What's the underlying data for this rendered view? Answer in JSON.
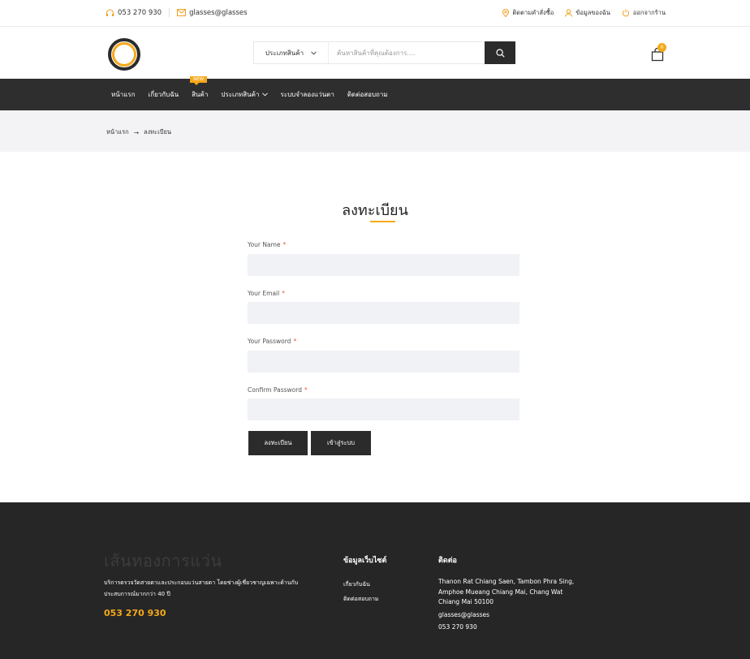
{
  "topbar": {
    "phone": "053 270 930",
    "email": "glasses@glasses",
    "track_order": "ติดตามคำสั่งซื้อ",
    "my_account": "ข้อมูลของฉัน",
    "logout": "ออกจากร้าน"
  },
  "header": {
    "search_category": "ประเภทสินค้า",
    "search_placeholder": "ค้นหาสินค้าที่คุณต้องการ....",
    "cart_count": "0"
  },
  "nav": {
    "items": [
      {
        "label": "หน้าแรก"
      },
      {
        "label": "เกี่ยวกับฉัน"
      },
      {
        "label": "สินค้า",
        "badge": "NEW"
      },
      {
        "label": "ประเภทสินค้า"
      },
      {
        "label": "ระบบจำลองแว่นตา"
      },
      {
        "label": "ติดต่อสอบถาม"
      }
    ]
  },
  "breadcrumb": {
    "home": "หน้าแรก",
    "arrow": "→",
    "current": "ลงทะเบียน"
  },
  "form": {
    "title": "ลงทะเบียน",
    "name_label": "Your Name",
    "email_label": "Your Email",
    "password_label": "Your Password",
    "confirm_label": "Confirm Password",
    "required_mark": "*",
    "register_button": "ลงทะเบียน",
    "login_button": "เข้าสู่ระบบ"
  },
  "footer": {
    "brand": "เส้นทองการแว่น",
    "description": "บริการตรวจวัดสายตาและประกอบแว่นสายตา โดยช่างผู้เชี่ยวชาญเฉพาะด้านกับประสบการณ์มากกว่า 40 ปี",
    "phone": "053 270 930",
    "info_heading": "ข้อมูลเว็บไซต์",
    "info_links": [
      "เกี่ยวกับฉัน",
      "ติดต่อสอบถาม"
    ],
    "contact_heading": "ติดต่อ",
    "address": "Thanon Rat Chiang Saen, Tambon Phra Sing, Amphoe Mueang Chiang Mai, Chang Wat Chiang Mai 50100",
    "email": "glasses@glasses",
    "contact_phone": "053 270 930"
  },
  "colors": {
    "accent": "#f5a91a",
    "dark": "#2e2e2e",
    "required": "#e85a4f"
  }
}
